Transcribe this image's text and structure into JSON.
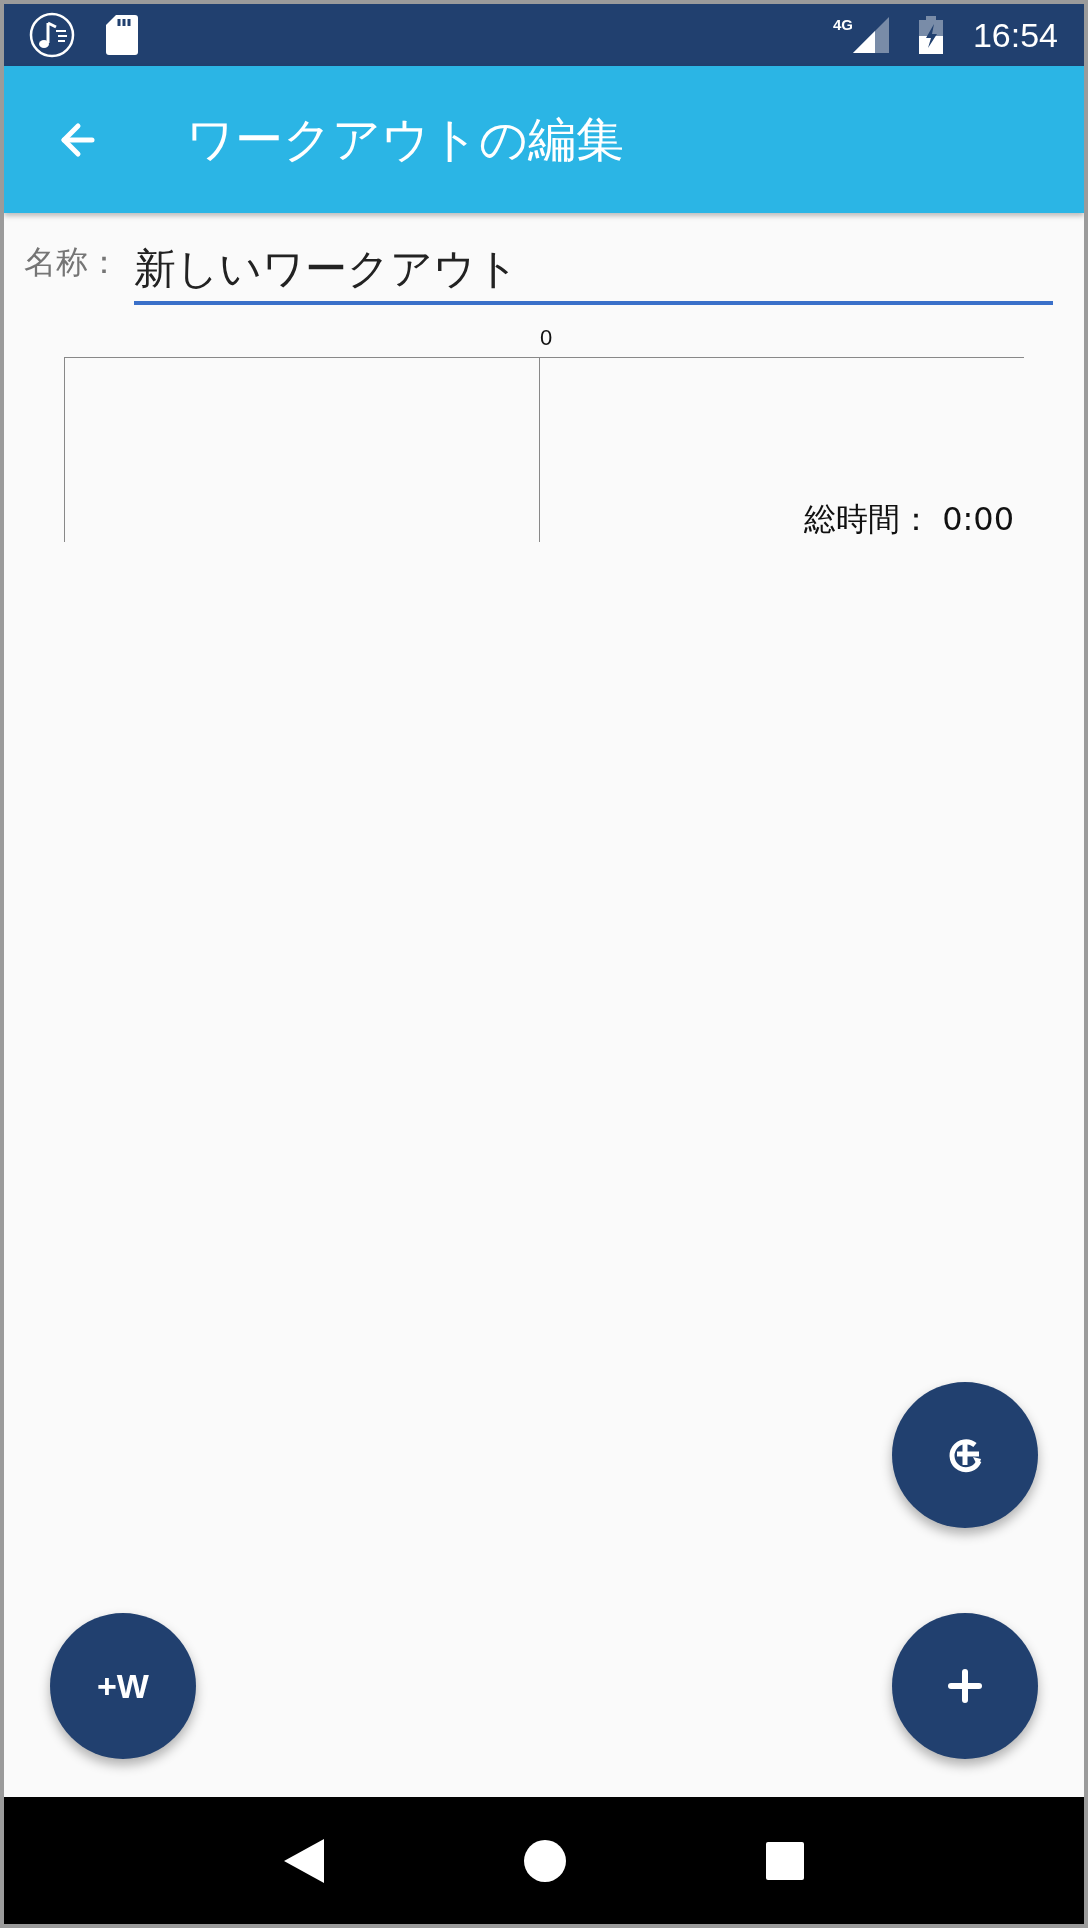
{
  "status_bar": {
    "time": "16:54",
    "network": "4G"
  },
  "app_bar": {
    "title": "ワークアウトの編集"
  },
  "name_field": {
    "label": "名称：",
    "value": "新しいワークアウト"
  },
  "timeline": {
    "axis_label": "0",
    "total_label": "総時間：",
    "total_value": "0:00"
  },
  "fabs": [
    {
      "kind": "repeat"
    },
    {
      "kind": "text",
      "label": "+W"
    },
    {
      "kind": "add"
    }
  ]
}
